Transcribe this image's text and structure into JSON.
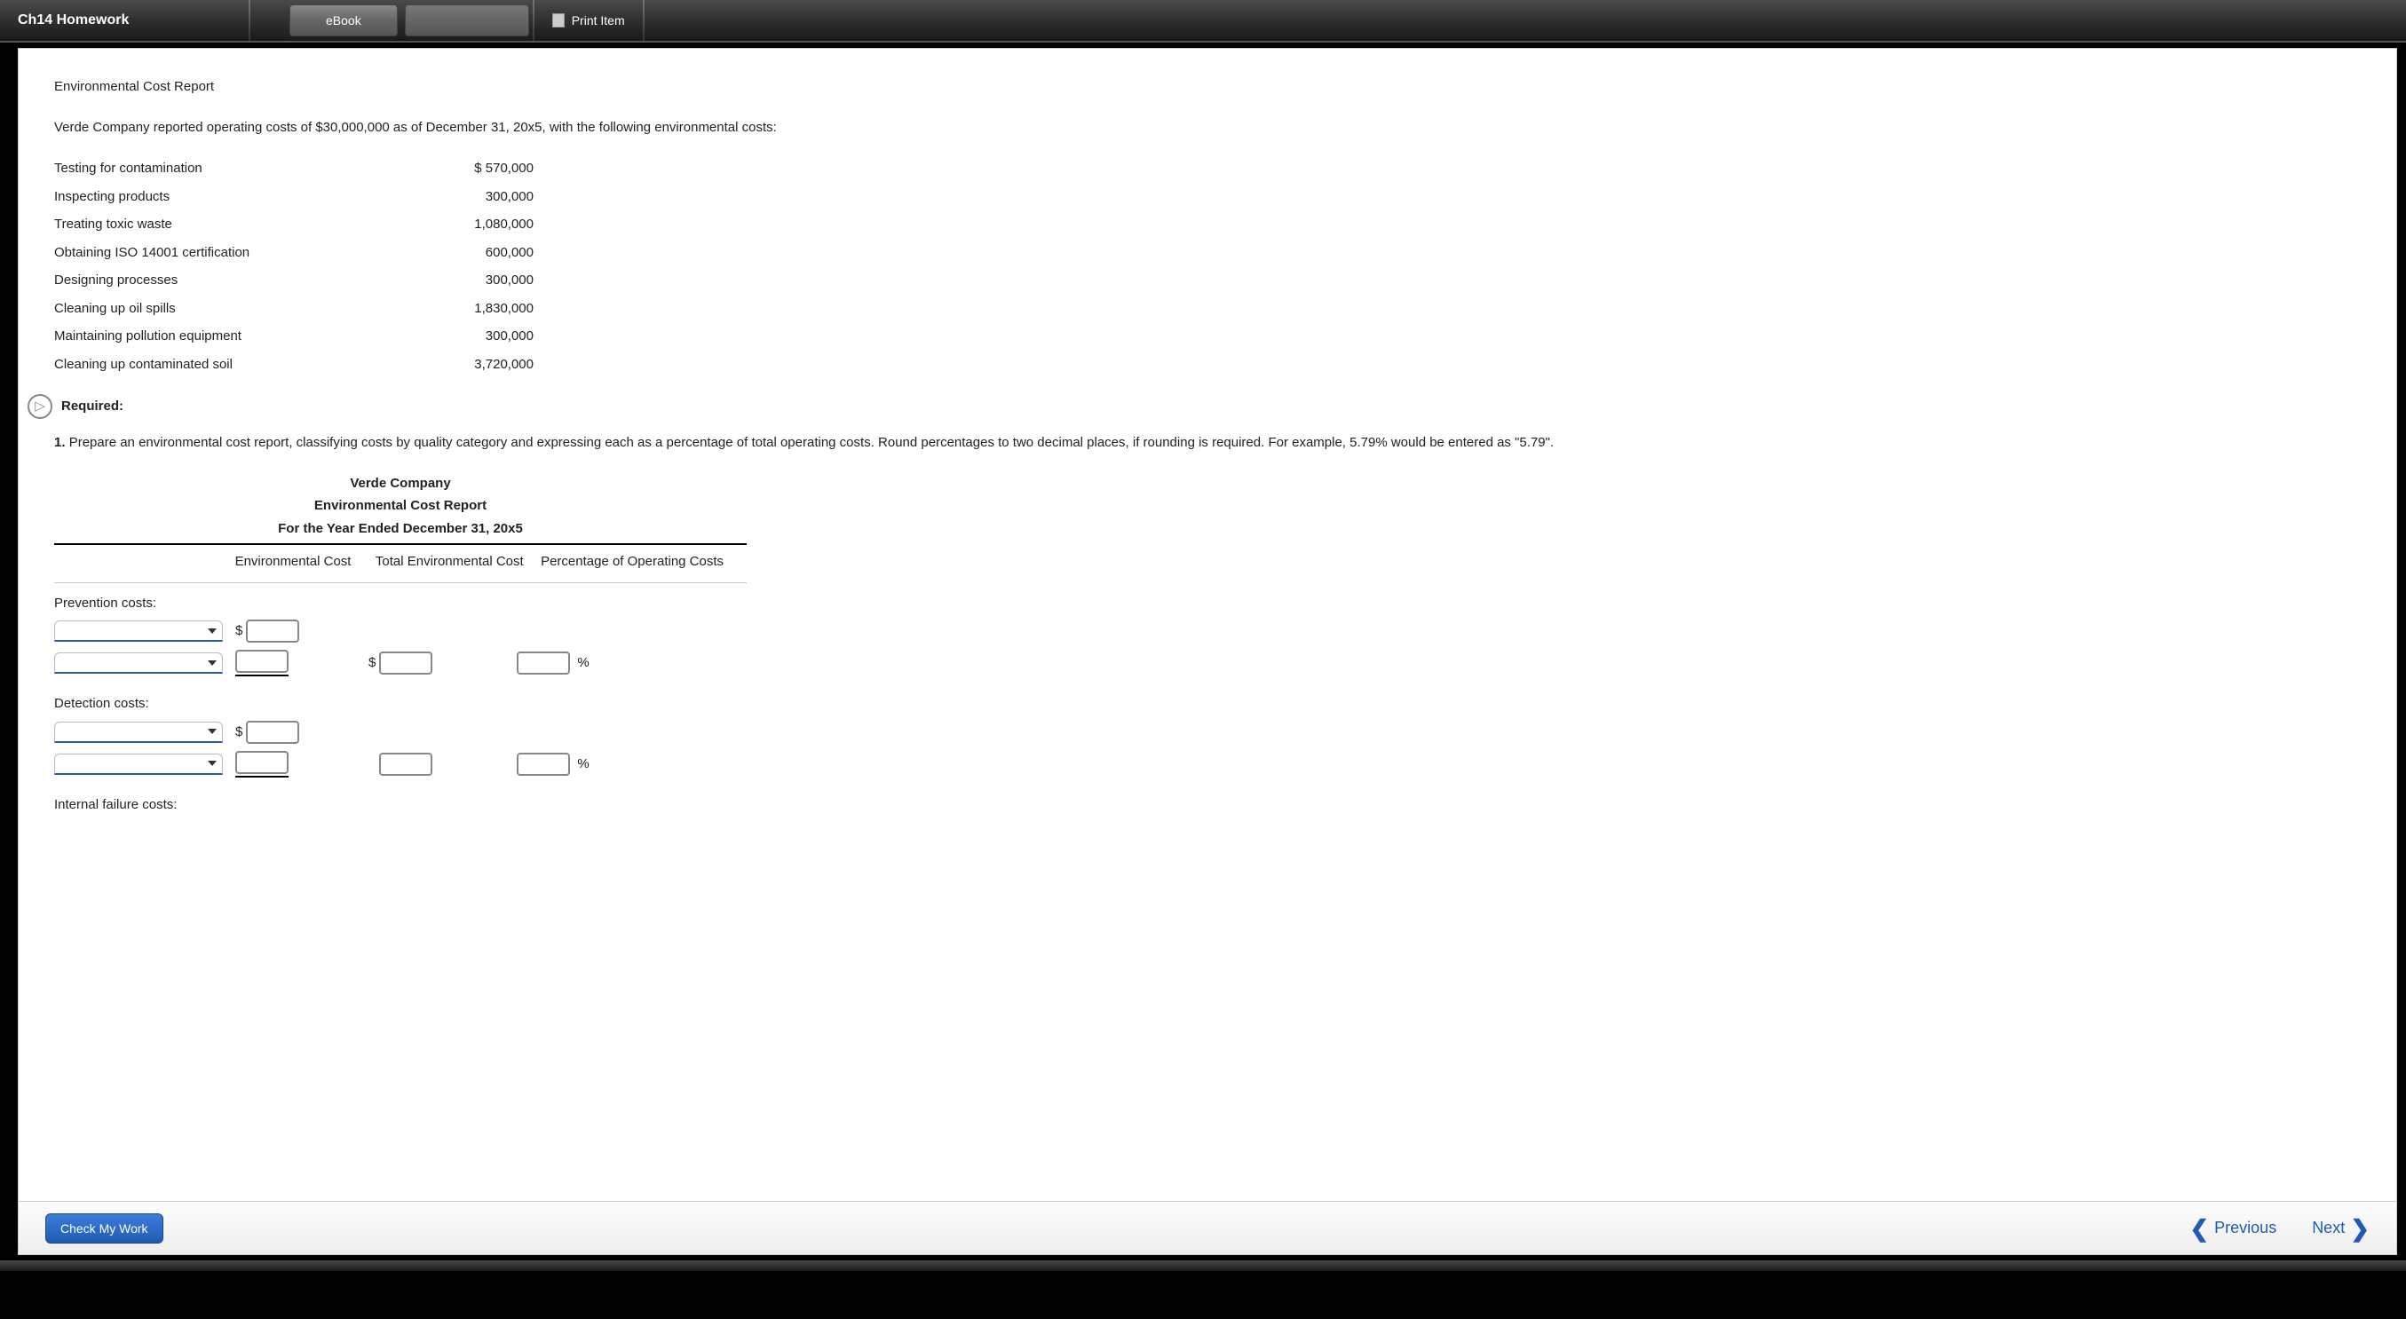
{
  "topbar": {
    "title": "Ch14 Homework",
    "ebook": "eBook",
    "print": "Print Item"
  },
  "page": {
    "title": "Environmental Cost Report",
    "intro": "Verde Company reported operating costs of $30,000,000 as of December 31, 20x5, with the following environmental costs:",
    "costs": [
      {
        "label": "Testing for contamination",
        "value": "$ 570,000"
      },
      {
        "label": "Inspecting products",
        "value": "300,000"
      },
      {
        "label": "Treating toxic waste",
        "value": "1,080,000"
      },
      {
        "label": "Obtaining ISO 14001 certification",
        "value": "600,000"
      },
      {
        "label": "Designing processes",
        "value": "300,000"
      },
      {
        "label": "Cleaning up oil spills",
        "value": "1,830,000"
      },
      {
        "label": "Maintaining pollution equipment",
        "value": "300,000"
      },
      {
        "label": "Cleaning up contaminated soil",
        "value": "3,720,000"
      }
    ],
    "required_label": "Required:",
    "q1_prefix": "1. ",
    "q1_text": "Prepare an environmental cost report, classifying costs by quality category and expressing each as a percentage of total operating costs. Round percentages to two decimal places, if rounding is required. For example, 5.79% would be entered as \"5.79\".",
    "report": {
      "t1": "Verde Company",
      "t2": "Environmental Cost Report",
      "t3": "For the Year Ended December 31, 20x5",
      "h_env": "Environmental Cost",
      "h_total": "Total Environmental Cost",
      "h_pct": "Percentage of Operating Costs",
      "cat1": "Prevention costs:",
      "cat2": "Detection costs:",
      "cat3": "Internal failure costs:",
      "dollar": "$",
      "pct": "%"
    }
  },
  "footer": {
    "check": "Check My Work",
    "prev": "Previous",
    "next": "Next"
  }
}
